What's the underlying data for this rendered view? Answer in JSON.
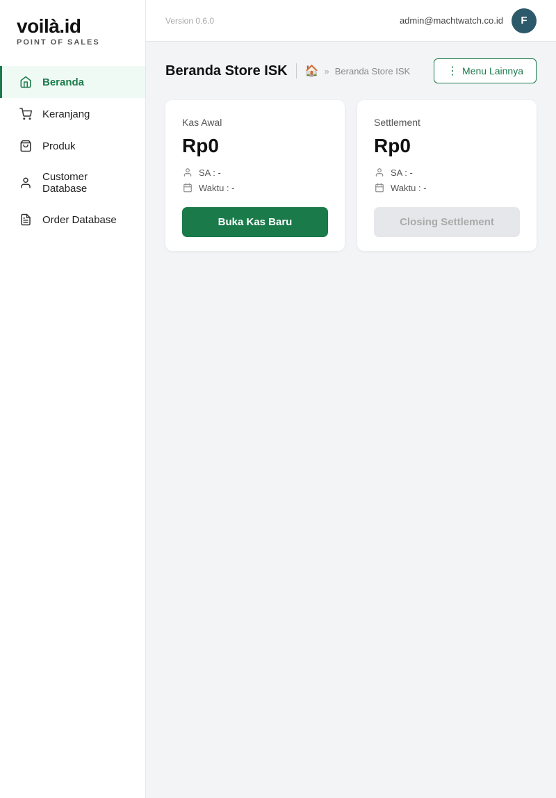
{
  "app": {
    "name": "voilà.id",
    "tagline": "POINT OF SALES",
    "version": "Version 0.6.0"
  },
  "topbar": {
    "user_email": "admin@machtwatch.co.id",
    "user_initial": "F"
  },
  "sidebar": {
    "items": [
      {
        "id": "beranda",
        "label": "Beranda",
        "icon": "home",
        "active": true
      },
      {
        "id": "keranjang",
        "label": "Keranjang",
        "icon": "cart",
        "active": false
      },
      {
        "id": "produk",
        "label": "Produk",
        "icon": "bag",
        "active": false
      },
      {
        "id": "customer-database",
        "label": "Customer Database",
        "icon": "person",
        "active": false
      },
      {
        "id": "order-database",
        "label": "Order Database",
        "icon": "doc",
        "active": false
      }
    ]
  },
  "page": {
    "title": "Beranda Store ISK",
    "breadcrumb_home": "🏠",
    "breadcrumb_arrow": "»",
    "breadcrumb_current": "Beranda Store ISK",
    "menu_button": "Menu Lainnya"
  },
  "kas_awal": {
    "label": "Kas Awal",
    "amount": "Rp0",
    "sa_label": "SA : -",
    "waktu_label": "Waktu : -",
    "button": "Buka Kas Baru"
  },
  "settlement": {
    "label": "Settlement",
    "amount": "Rp0",
    "sa_label": "SA : -",
    "waktu_label": "Waktu : -",
    "button": "Closing Settlement"
  }
}
